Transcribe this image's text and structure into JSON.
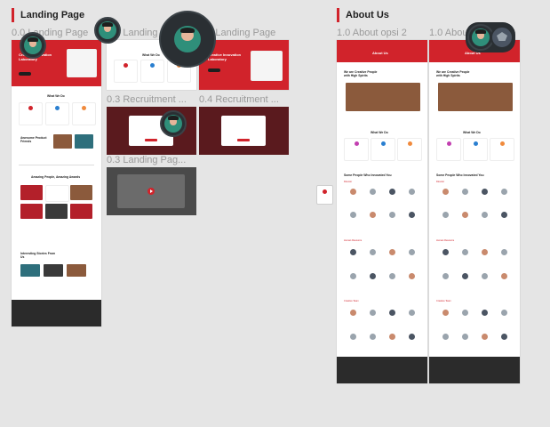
{
  "sections": {
    "landing": {
      "title": "Landing Page"
    },
    "about": {
      "title": "About Us"
    }
  },
  "frames": {
    "f01": {
      "label": "0.0 Landing Page"
    },
    "f02": {
      "label": "0.1 Landing Page"
    },
    "f03": {
      "label": "0.2 Landing Page"
    },
    "f04": {
      "label": "0.3 Recruitment ..."
    },
    "f05": {
      "label": "0.4 Recruitment ..."
    },
    "f06": {
      "label": "0.3 Landing Pag..."
    },
    "about1": {
      "label": "1.0 About opsi 2"
    },
    "about2": {
      "label": "1.0 About opsi 1"
    }
  },
  "landing_content": {
    "hero_title": "Creative Innovation Laboratory",
    "what_we_do": "What We Do",
    "awesome_product": "Awesome Product Friends",
    "amazing_people": "Amazing People, Amazing Awards",
    "interesting_stories": "Interesting Stories From Us"
  },
  "about_content": {
    "hero_title": "About Us",
    "intro": "We are Creative People with High Spirits",
    "what_we_do": "What We Do",
    "people_title": "Some People Who Innovated You",
    "group_a": "Director",
    "group_b": "Human Resource",
    "group_c": "Creative Team"
  },
  "colors": {
    "accent": "#d1232b",
    "canvas": "#e5e5e5",
    "footer": "#2b2b2b"
  },
  "icons": {
    "collaborator": "user-avatar-icon",
    "comment": "comment-pin-icon",
    "video": "play-icon"
  }
}
